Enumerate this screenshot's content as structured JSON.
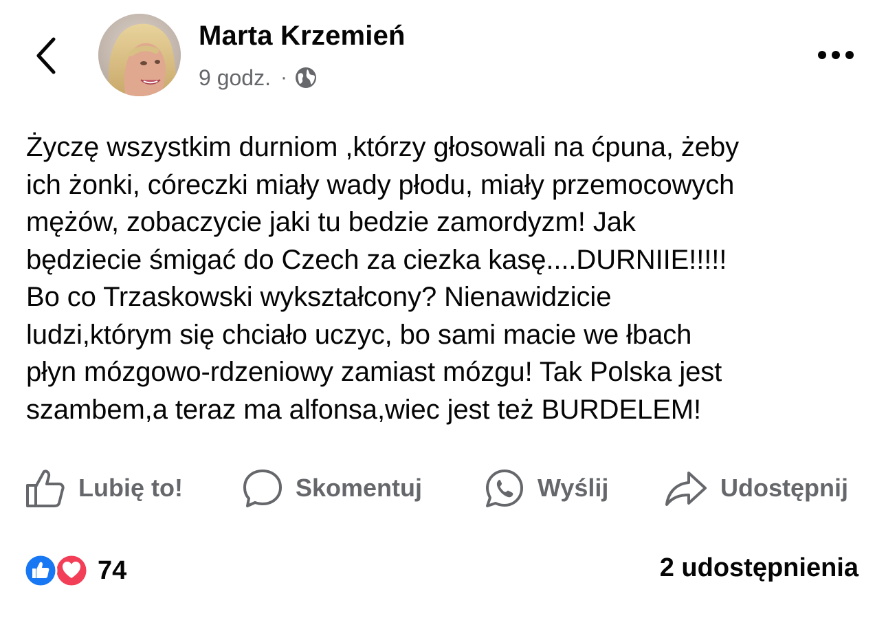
{
  "post": {
    "author": "Marta Krzemień",
    "time": "9 godz.",
    "separator": "·",
    "audience_icon": "globe-icon",
    "text": "Życzę wszystkim durniom ,którzy głosowali na ćpuna, żeby\nich żonki, córeczki miały wady płodu, miały przemocowych\nmężów, zobaczycie jaki tu bedzie zamordyzm! Jak\nbędziecie śmigać do Czech za ciezka kasę....DURNIIE!!!!!\nBo co Trzaskowski wykształcony? Nienawidzicie\nludzi,którym się chciało uczyc, bo sami macie we łbach\npłyn mózgowo-rdzeniowy zamiast mózgu! Tak Polska jest\nszambem,a teraz ma alfonsa,wiec jest też BURDELEM!"
  },
  "actions": {
    "like": "Lubię to!",
    "comment": "Skomentuj",
    "send": "Wyślij",
    "share": "Udostępnij"
  },
  "stats": {
    "reaction_count": "74",
    "shares": "2 udostępnienia"
  },
  "colors": {
    "text": "#050505",
    "secondary": "#65676b",
    "like_blue": "#1877f2",
    "love_red": "#f33e58"
  }
}
